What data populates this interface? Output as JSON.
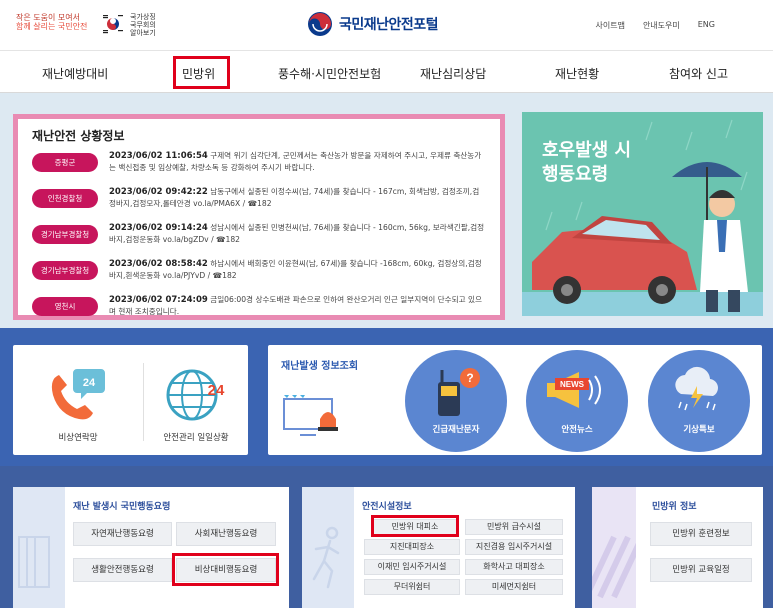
{
  "header": {
    "slogan": [
      "작은 도움이 모여서",
      "함께 살리는 국민안전",
      ""
    ],
    "gov_text": [
      "국가상징",
      "국무회의",
      "알아보기"
    ],
    "logo_text": "국민재난안전포털",
    "utils": [
      "사이트맵",
      "안내도우미",
      "ENG"
    ]
  },
  "nav": {
    "items": [
      "재난예방대비",
      "민방위",
      "풍수해·시민안전보험",
      "재난심리상담",
      "재난현황",
      "참여와 신고"
    ]
  },
  "status": {
    "title": "재난안전 상황정보",
    "items": [
      {
        "badge": "증평군",
        "datetime": "2023/06/02 11:06:54",
        "text": "구제역 위기 심각단계, 군민께서는 축산농가 방문을 자제하여 주시고, 우제류 축산농가는 백신접종 및 임상예찰, 차량소독 등 강화하여 주시기 바랍니다."
      },
      {
        "badge": "인천경찰청",
        "datetime": "2023/06/02 09:42:22",
        "text": "남동구에서 실종된 이정수씨(남, 74세)를 찾습니다 - 167cm, 회색남방, 검정조끼,검정바지,검정모자,롤테안경 vo.la/PMA6X / ☎182"
      },
      {
        "badge": "경기남부경찰청",
        "datetime": "2023/06/02 09:14:24",
        "text": "성남시에서 실종된 민병천씨(남, 76세)를 찾습니다 - 160cm, 56kg, 보라색긴팔,검정바지,검정운동화 vo.la/bgZDv / ☎182"
      },
      {
        "badge": "경기남부경찰청",
        "datetime": "2023/06/02 08:58:42",
        "text": "하남시에서 배회중인 이윤현씨(남, 67세)를 찾습니다 -168cm, 60kg, 검정상의,검정바지,흰색운동화 vo.la/PJYvD / ☎182"
      },
      {
        "badge": "영천시",
        "datetime": "2023/06/02 07:24:09",
        "text": "금일06:00경 상수도배관 파손으로 인하여 완산오거리 인근 일부지역이 단수되고 있으며 현재 조치중입니다."
      }
    ]
  },
  "banner": {
    "line1": "호우발생 시",
    "line2": "행동요령"
  },
  "quick": {
    "emergency_label": "비상연락망",
    "safety_label": "안전관리 일일상황",
    "icon_number": "24"
  },
  "disaster_info": {
    "title": "재난발생 정보조회",
    "buttons": [
      "긴급재난문자",
      "안전뉴스",
      "기상특보"
    ],
    "news_text": "NEWS"
  },
  "guide_panel": {
    "title": "재난 발생시 국민행동요령",
    "buttons": [
      "자연재난행동요령",
      "사회재난행동요령",
      "생활안전행동요령",
      "비상대비행동요령"
    ]
  },
  "facility_panel": {
    "title": "안전시설정보",
    "buttons": [
      "민방위 대피소",
      "민방위 급수시설",
      "지진대피장소",
      "지진겸용 임시주거시설",
      "이재민 임시주거시설",
      "화학사고 대피장소",
      "무더위쉼터",
      "미세먼지쉼터"
    ]
  },
  "civil_panel": {
    "title": "민방위 정보",
    "buttons": [
      "민방위 훈련정보",
      "민방위 교육일정"
    ]
  },
  "colors": {
    "primary": "#0a3a8c",
    "badge": "#c7155c",
    "highlight": "#e0001b",
    "band_blue": "#3b64b2"
  }
}
